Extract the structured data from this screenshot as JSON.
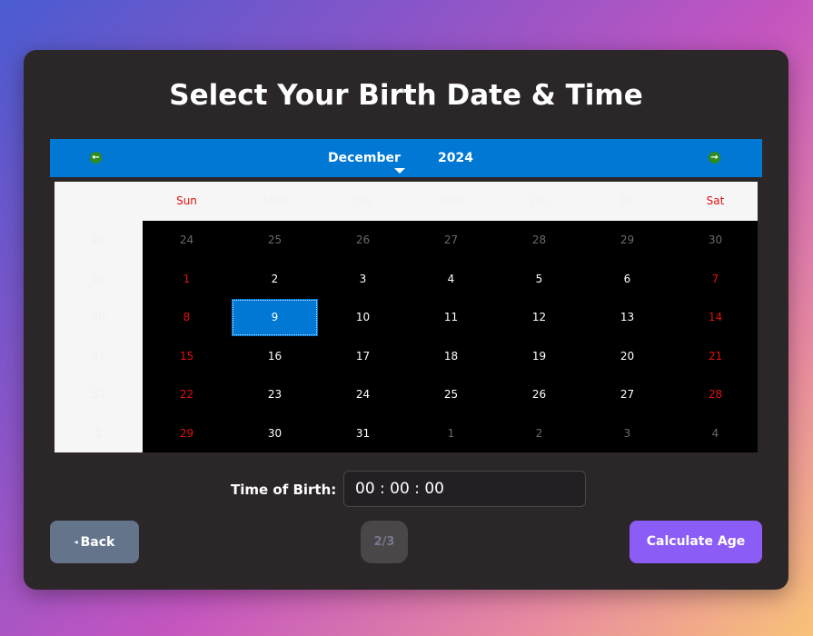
{
  "title": "Select Your Birth Date & Time",
  "calendar": {
    "month": "December",
    "year": "2024",
    "days_of_week": [
      "Sun",
      "Mon",
      "Tue",
      "Wed",
      "Thu",
      "Fri",
      "Sat"
    ],
    "weeks": [
      {
        "num": "48",
        "days": [
          "24",
          "25",
          "26",
          "27",
          "28",
          "29",
          "30"
        ]
      },
      {
        "num": "49",
        "days": [
          "1",
          "2",
          "3",
          "4",
          "5",
          "6",
          "7"
        ]
      },
      {
        "num": "50",
        "days": [
          "8",
          "9",
          "10",
          "11",
          "12",
          "13",
          "14"
        ]
      },
      {
        "num": "51",
        "days": [
          "15",
          "16",
          "17",
          "18",
          "19",
          "20",
          "21"
        ]
      },
      {
        "num": "52",
        "days": [
          "22",
          "23",
          "24",
          "25",
          "26",
          "27",
          "28"
        ]
      },
      {
        "num": "1",
        "days": [
          "29",
          "30",
          "31",
          "1",
          "2",
          "3",
          "4"
        ]
      }
    ],
    "selected_day": "9",
    "colors": {
      "header": "#0078d4",
      "weekend": "#e01010",
      "selected": "#0078d4"
    }
  },
  "time": {
    "label": "Time of Birth:",
    "value": "00 : 00 : 00"
  },
  "buttons": {
    "back": "Back",
    "back_icon": "◂",
    "calculate": "Calculate Age"
  },
  "step": "2/3"
}
